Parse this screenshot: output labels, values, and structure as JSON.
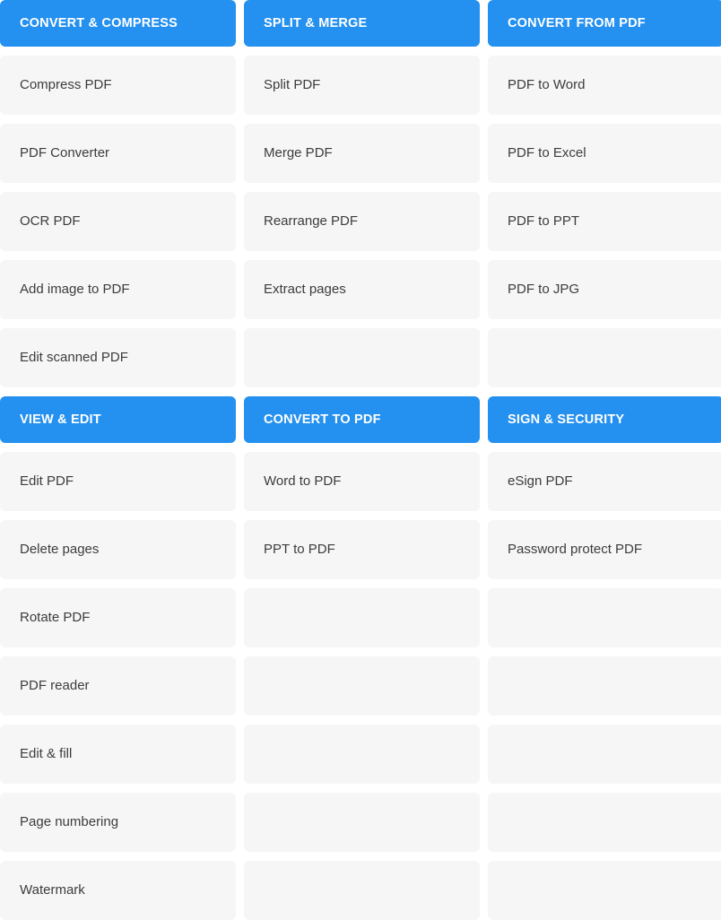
{
  "theme": {
    "header_background": "#2490ef",
    "header_text": "#ffffff",
    "cell_background": "#f6f6f7",
    "cell_text": "#3c3c3c",
    "page_background": "#ffffff"
  },
  "sections": [
    {
      "columns": [
        {
          "header": "CONVERT & COMPRESS",
          "items": [
            "Compress PDF",
            "PDF Converter",
            "OCR PDF",
            "Add image to PDF",
            "Edit scanned PDF"
          ]
        },
        {
          "header": "SPLIT & MERGE",
          "items": [
            "Split PDF",
            "Merge PDF",
            "Rearrange PDF",
            "Extract pages"
          ]
        },
        {
          "header": "CONVERT FROM PDF",
          "items": [
            "PDF to Word",
            "PDF to Excel",
            "PDF to PPT",
            "PDF to JPG"
          ]
        }
      ]
    },
    {
      "columns": [
        {
          "header": "VIEW & EDIT",
          "items": [
            "Edit PDF",
            "Delete pages",
            "Rotate PDF",
            "PDF reader",
            "Edit & fill",
            "Page numbering",
            "Watermark"
          ]
        },
        {
          "header": "CONVERT TO PDF",
          "items": [
            "Word to PDF",
            "PPT to PDF"
          ]
        },
        {
          "header": "SIGN & SECURITY",
          "items": [
            "eSign PDF",
            "Password protect PDF"
          ]
        }
      ]
    }
  ]
}
